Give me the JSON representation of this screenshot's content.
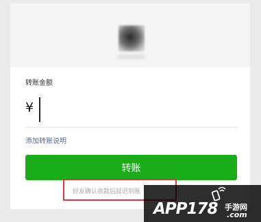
{
  "transfer": {
    "amount_label": "转账金额",
    "currency_symbol": "¥",
    "amount_value": "",
    "add_note_link": "添加转账说明",
    "transfer_button": "转账",
    "hint_text": "好友确认收款后延迟到账"
  },
  "colors": {
    "button_green": "#1aad19",
    "link_blue": "#576b95",
    "highlight_red": "#d9363e"
  },
  "watermark": {
    "main_text": "APP178",
    "cn_text": "手游网",
    "domain_text": ".com",
    "icon": "phone-signal-icon"
  }
}
